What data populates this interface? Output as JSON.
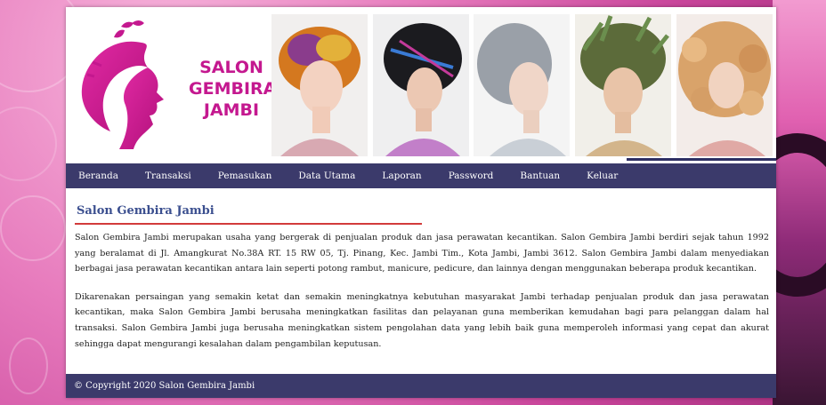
{
  "brand": {
    "name_lines": [
      "SALON",
      "GEMBIRA",
      "JAMBI"
    ],
    "accent_color": "#c4188f"
  },
  "nav": {
    "items": [
      "Beranda",
      "Transaksi",
      "Pemasukan",
      "Data Utama",
      "Laporan",
      "Password",
      "Bantuan",
      "Keluar"
    ]
  },
  "main": {
    "title": "Salon Gembira Jambi",
    "paragraphs": [
      "Salon Gembira Jambi merupakan usaha yang bergerak di penjualan produk dan jasa perawatan kecantikan. Salon Gembira Jambi berdiri sejak tahun 1992 yang beralamat di Jl. Amangkurat No.38A RT. 15 RW 05, Tj. Pinang, Kec. Jambi Tim., Kota Jambi, Jambi 3612. Salon Gembira Jambi dalam menyediakan berbagai jasa perawatan kecantikan antara lain seperti potong rambut, manicure, pedicure, dan lainnya dengan menggunakan beberapa produk kecantikan.",
      "Dikarenakan persaingan yang semakin ketat dan semakin meningkatnya kebutuhan masyarakat Jambi terhadap penjualan produk dan jasa perawatan kecantikan, maka Salon Gembira Jambi berusaha meningkatkan fasilitas dan pelayanan guna memberikan kemudahan bagi para pelanggan dalam hal transaksi. Salon Gembira Jambi juga berusaha meningkatkan sistem pengolahan data yang lebih baik guna memperoleh informasi yang cepat dan akurat sehingga dapat mengurangi kesalahan dalam pengambilan keputusan."
    ]
  },
  "footer": {
    "text": "© Copyright 2020 Salon Gembira Jambi"
  },
  "colors": {
    "nav_bg": "#3b3a6b",
    "title": "#3b4f8f",
    "title_underline": "#d23b3b"
  }
}
